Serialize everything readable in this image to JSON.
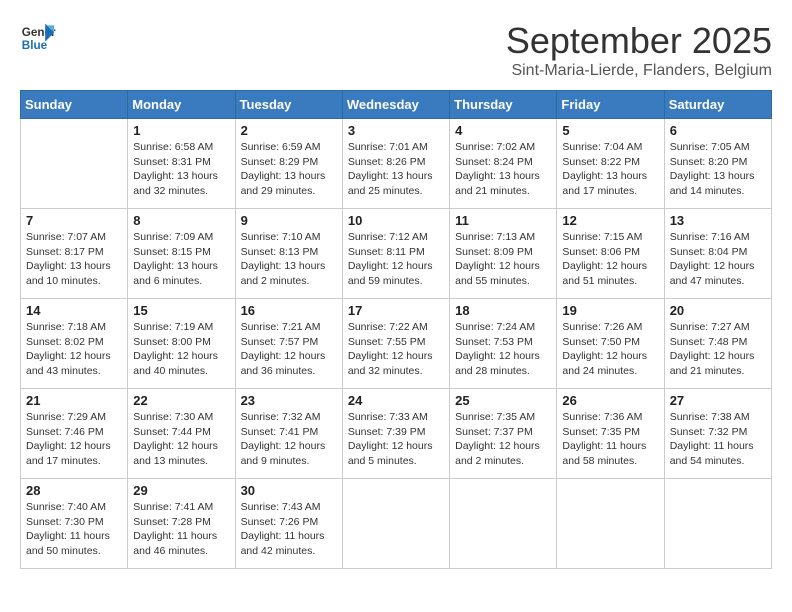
{
  "header": {
    "logo_line1": "General",
    "logo_line2": "Blue",
    "month": "September 2025",
    "location": "Sint-Maria-Lierde, Flanders, Belgium"
  },
  "weekdays": [
    "Sunday",
    "Monday",
    "Tuesday",
    "Wednesday",
    "Thursday",
    "Friday",
    "Saturday"
  ],
  "weeks": [
    [
      {
        "day": "",
        "info": ""
      },
      {
        "day": "1",
        "info": "Sunrise: 6:58 AM\nSunset: 8:31 PM\nDaylight: 13 hours\nand 32 minutes."
      },
      {
        "day": "2",
        "info": "Sunrise: 6:59 AM\nSunset: 8:29 PM\nDaylight: 13 hours\nand 29 minutes."
      },
      {
        "day": "3",
        "info": "Sunrise: 7:01 AM\nSunset: 8:26 PM\nDaylight: 13 hours\nand 25 minutes."
      },
      {
        "day": "4",
        "info": "Sunrise: 7:02 AM\nSunset: 8:24 PM\nDaylight: 13 hours\nand 21 minutes."
      },
      {
        "day": "5",
        "info": "Sunrise: 7:04 AM\nSunset: 8:22 PM\nDaylight: 13 hours\nand 17 minutes."
      },
      {
        "day": "6",
        "info": "Sunrise: 7:05 AM\nSunset: 8:20 PM\nDaylight: 13 hours\nand 14 minutes."
      }
    ],
    [
      {
        "day": "7",
        "info": "Sunrise: 7:07 AM\nSunset: 8:17 PM\nDaylight: 13 hours\nand 10 minutes."
      },
      {
        "day": "8",
        "info": "Sunrise: 7:09 AM\nSunset: 8:15 PM\nDaylight: 13 hours\nand 6 minutes."
      },
      {
        "day": "9",
        "info": "Sunrise: 7:10 AM\nSunset: 8:13 PM\nDaylight: 13 hours\nand 2 minutes."
      },
      {
        "day": "10",
        "info": "Sunrise: 7:12 AM\nSunset: 8:11 PM\nDaylight: 12 hours\nand 59 minutes."
      },
      {
        "day": "11",
        "info": "Sunrise: 7:13 AM\nSunset: 8:09 PM\nDaylight: 12 hours\nand 55 minutes."
      },
      {
        "day": "12",
        "info": "Sunrise: 7:15 AM\nSunset: 8:06 PM\nDaylight: 12 hours\nand 51 minutes."
      },
      {
        "day": "13",
        "info": "Sunrise: 7:16 AM\nSunset: 8:04 PM\nDaylight: 12 hours\nand 47 minutes."
      }
    ],
    [
      {
        "day": "14",
        "info": "Sunrise: 7:18 AM\nSunset: 8:02 PM\nDaylight: 12 hours\nand 43 minutes."
      },
      {
        "day": "15",
        "info": "Sunrise: 7:19 AM\nSunset: 8:00 PM\nDaylight: 12 hours\nand 40 minutes."
      },
      {
        "day": "16",
        "info": "Sunrise: 7:21 AM\nSunset: 7:57 PM\nDaylight: 12 hours\nand 36 minutes."
      },
      {
        "day": "17",
        "info": "Sunrise: 7:22 AM\nSunset: 7:55 PM\nDaylight: 12 hours\nand 32 minutes."
      },
      {
        "day": "18",
        "info": "Sunrise: 7:24 AM\nSunset: 7:53 PM\nDaylight: 12 hours\nand 28 minutes."
      },
      {
        "day": "19",
        "info": "Sunrise: 7:26 AM\nSunset: 7:50 PM\nDaylight: 12 hours\nand 24 minutes."
      },
      {
        "day": "20",
        "info": "Sunrise: 7:27 AM\nSunset: 7:48 PM\nDaylight: 12 hours\nand 21 minutes."
      }
    ],
    [
      {
        "day": "21",
        "info": "Sunrise: 7:29 AM\nSunset: 7:46 PM\nDaylight: 12 hours\nand 17 minutes."
      },
      {
        "day": "22",
        "info": "Sunrise: 7:30 AM\nSunset: 7:44 PM\nDaylight: 12 hours\nand 13 minutes."
      },
      {
        "day": "23",
        "info": "Sunrise: 7:32 AM\nSunset: 7:41 PM\nDaylight: 12 hours\nand 9 minutes."
      },
      {
        "day": "24",
        "info": "Sunrise: 7:33 AM\nSunset: 7:39 PM\nDaylight: 12 hours\nand 5 minutes."
      },
      {
        "day": "25",
        "info": "Sunrise: 7:35 AM\nSunset: 7:37 PM\nDaylight: 12 hours\nand 2 minutes."
      },
      {
        "day": "26",
        "info": "Sunrise: 7:36 AM\nSunset: 7:35 PM\nDaylight: 11 hours\nand 58 minutes."
      },
      {
        "day": "27",
        "info": "Sunrise: 7:38 AM\nSunset: 7:32 PM\nDaylight: 11 hours\nand 54 minutes."
      }
    ],
    [
      {
        "day": "28",
        "info": "Sunrise: 7:40 AM\nSunset: 7:30 PM\nDaylight: 11 hours\nand 50 minutes."
      },
      {
        "day": "29",
        "info": "Sunrise: 7:41 AM\nSunset: 7:28 PM\nDaylight: 11 hours\nand 46 minutes."
      },
      {
        "day": "30",
        "info": "Sunrise: 7:43 AM\nSunset: 7:26 PM\nDaylight: 11 hours\nand 42 minutes."
      },
      {
        "day": "",
        "info": ""
      },
      {
        "day": "",
        "info": ""
      },
      {
        "day": "",
        "info": ""
      },
      {
        "day": "",
        "info": ""
      }
    ]
  ]
}
